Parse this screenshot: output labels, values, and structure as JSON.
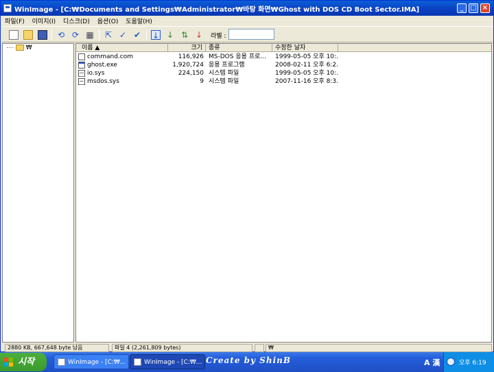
{
  "window": {
    "title": "WinImage - [C:₩Documents and Settings₩Administrator₩바탕 화면₩Ghost with DOS CD Boot Sector.IMA]"
  },
  "menu": [
    "파일(F)",
    "이미지(I)",
    "디스크(D)",
    "옵션(O)",
    "도움말(H)"
  ],
  "toolbar": {
    "label_caption": "라벨 :",
    "label_value": ""
  },
  "tree": {
    "root_label": "₩"
  },
  "columns": [
    "이름 ▲",
    "크기",
    "종류",
    "수정한 날자"
  ],
  "files": [
    {
      "name": "command.com",
      "size": "116,926",
      "type": "MS-DOS 응용 프로...",
      "modified": "1999-05-05  오후 10:...",
      "icon": "com"
    },
    {
      "name": "ghost.exe",
      "size": "1,920,724",
      "type": "응용 프로그램",
      "modified": "2008-02-11  오후 6:2...",
      "icon": "exe"
    },
    {
      "name": "io.sys",
      "size": "224,150",
      "type": "시스템 파일",
      "modified": "1999-05-05  오후 10:...",
      "icon": "sys"
    },
    {
      "name": "msdos.sys",
      "size": "9",
      "type": "시스템 파일",
      "modified": "2007-11-16  오후 8:3...",
      "icon": "sys"
    }
  ],
  "status": {
    "free": "2880 KB, 667,648 byte 남음",
    "count": "파일 4 (2,261,809 bytes)",
    "path": "₩"
  },
  "taskbar": {
    "start_label": "시작",
    "tasks": [
      "WinImage - [C:₩...",
      "WinImage - [C:₩..."
    ],
    "brand": "Create by ShinB",
    "ime": "A 漢",
    "clock": "오후 6:19"
  },
  "colors": {
    "title_bar": "#0a4fcc",
    "start_button": "#3a9a2c",
    "taskbar": "#245edb"
  }
}
